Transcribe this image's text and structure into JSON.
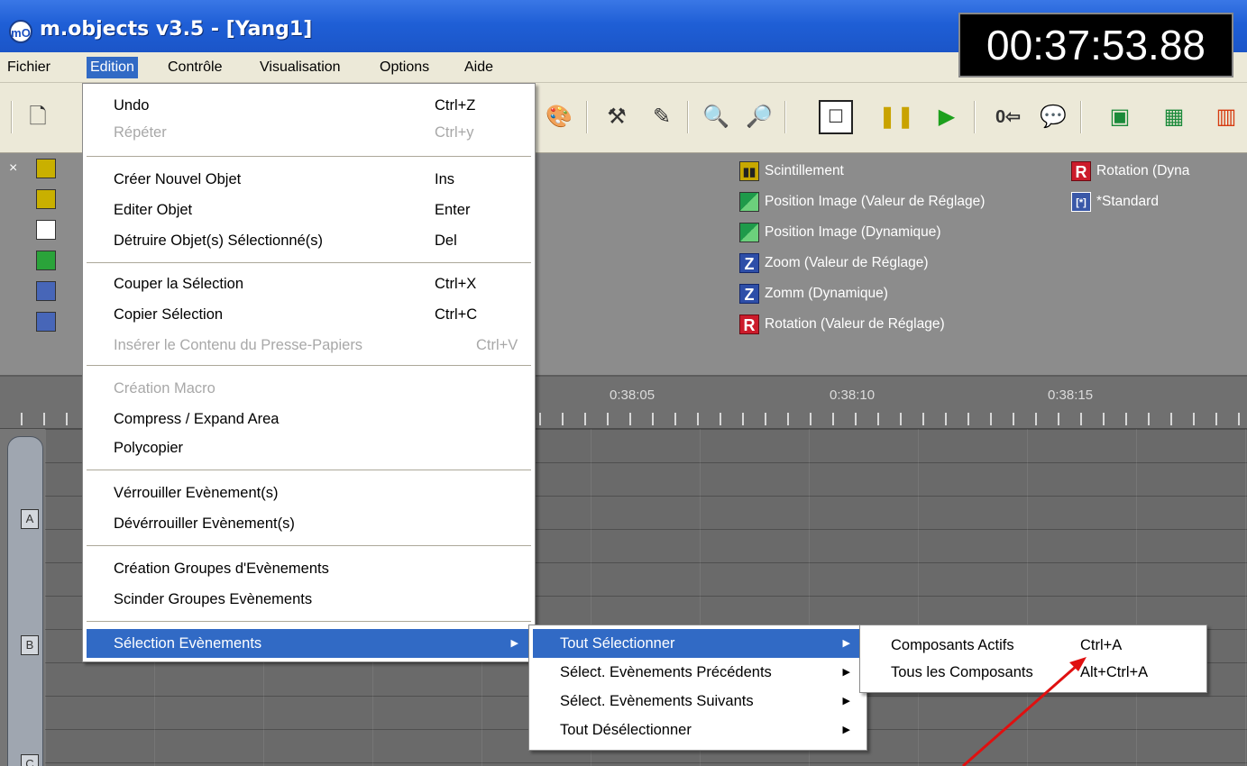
{
  "window": {
    "title": "m.objects v3.5 - [Yang1]",
    "timecode": "00:37:53.88"
  },
  "menubar": {
    "items": [
      "Fichier",
      "Edition",
      "Contrôle",
      "Visualisation",
      "Options",
      "Aide"
    ],
    "active": "Edition"
  },
  "edition_menu": {
    "items": [
      {
        "label": "Undo",
        "shortcut": "Ctrl+Z",
        "enabled": true
      },
      {
        "label": "Répéter",
        "shortcut": "Ctrl+y",
        "enabled": false
      },
      {
        "label": "Créer Nouvel Objet",
        "shortcut": "Ins",
        "enabled": true
      },
      {
        "label": "Editer Objet",
        "shortcut": "Enter",
        "enabled": true
      },
      {
        "label": "Détruire Objet(s) Sélectionné(s)",
        "shortcut": "Del",
        "enabled": true
      },
      {
        "label": "Couper la Sélection",
        "shortcut": "Ctrl+X",
        "enabled": true
      },
      {
        "label": "Copier Sélection",
        "shortcut": "Ctrl+C",
        "enabled": true
      },
      {
        "label": "Insérer le Contenu du Presse-Papiers",
        "shortcut": "Ctrl+V",
        "enabled": false
      },
      {
        "label": "Création Macro",
        "shortcut": "",
        "enabled": false
      },
      {
        "label": "Compress / Expand Area",
        "shortcut": "",
        "enabled": true
      },
      {
        "label": "Polycopier",
        "shortcut": "",
        "enabled": true
      },
      {
        "label": "Vérrouiller Evènement(s)",
        "shortcut": "",
        "enabled": true
      },
      {
        "label": "Dévérrouiller Evènement(s)",
        "shortcut": "",
        "enabled": true
      },
      {
        "label": "Création Groupes d'Evènements",
        "shortcut": "",
        "enabled": true
      },
      {
        "label": "Scinder Groupes Evènements",
        "shortcut": "",
        "enabled": true
      },
      {
        "label": "Sélection Evènements",
        "shortcut": "",
        "enabled": true,
        "submenu": true,
        "highlighted": true
      }
    ]
  },
  "selection_submenu": {
    "items": [
      {
        "label": "Tout Sélectionner",
        "highlighted": true
      },
      {
        "label": "Sélect. Evènements Précédents"
      },
      {
        "label": "Sélect. Evènements Suivants"
      },
      {
        "label": "Tout Désélectionner"
      }
    ]
  },
  "tout_selectionner_submenu": {
    "items": [
      {
        "label": "Composants Actifs",
        "shortcut": "Ctrl+A"
      },
      {
        "label": "Tous les Composants",
        "shortcut": "Alt+Ctrl+A"
      }
    ]
  },
  "effects_panel": {
    "column1": [
      {
        "label": "Scintillement",
        "icon": "scintillement-icon",
        "glyph": "▮▮"
      },
      {
        "label": "Position Image (Valeur de Réglage)",
        "icon": "position-image-icon",
        "glyph": ""
      },
      {
        "label": "Position Image (Dynamique)",
        "icon": "position-image-dynamic-icon",
        "glyph": ""
      },
      {
        "label": "Zoom (Valeur de Réglage)",
        "icon": "zoom-icon",
        "glyph": "Z"
      },
      {
        "label": "Zomm (Dynamique)",
        "icon": "zoom-dynamic-icon",
        "glyph": "Z"
      },
      {
        "label": "Rotation (Valeur de Réglage)",
        "icon": "rotation-icon",
        "glyph": "R"
      }
    ],
    "column2": [
      {
        "label": "Rotation (Dyna",
        "icon": "rotation-dynamic-icon",
        "glyph": "R"
      },
      {
        "label": "*Standard",
        "icon": "standard-icon",
        "glyph": "[*]"
      }
    ]
  },
  "timeline": {
    "ruler_labels": [
      "0:38:05",
      "0:38:10",
      "0:38:15"
    ],
    "tracks": [
      "A",
      "B",
      "C"
    ]
  },
  "toolbar": {
    "icons": [
      "new-document-icon",
      "palette-icon",
      "hammer-icon",
      "pen-icon",
      "zoom-in-icon",
      "zoom-out-icon",
      "frame-icon",
      "pause-icon",
      "play-icon",
      "counter-icon",
      "speech-icon",
      "image-icon",
      "presentation-icon",
      "grid-icon"
    ],
    "counter_label": "0"
  }
}
